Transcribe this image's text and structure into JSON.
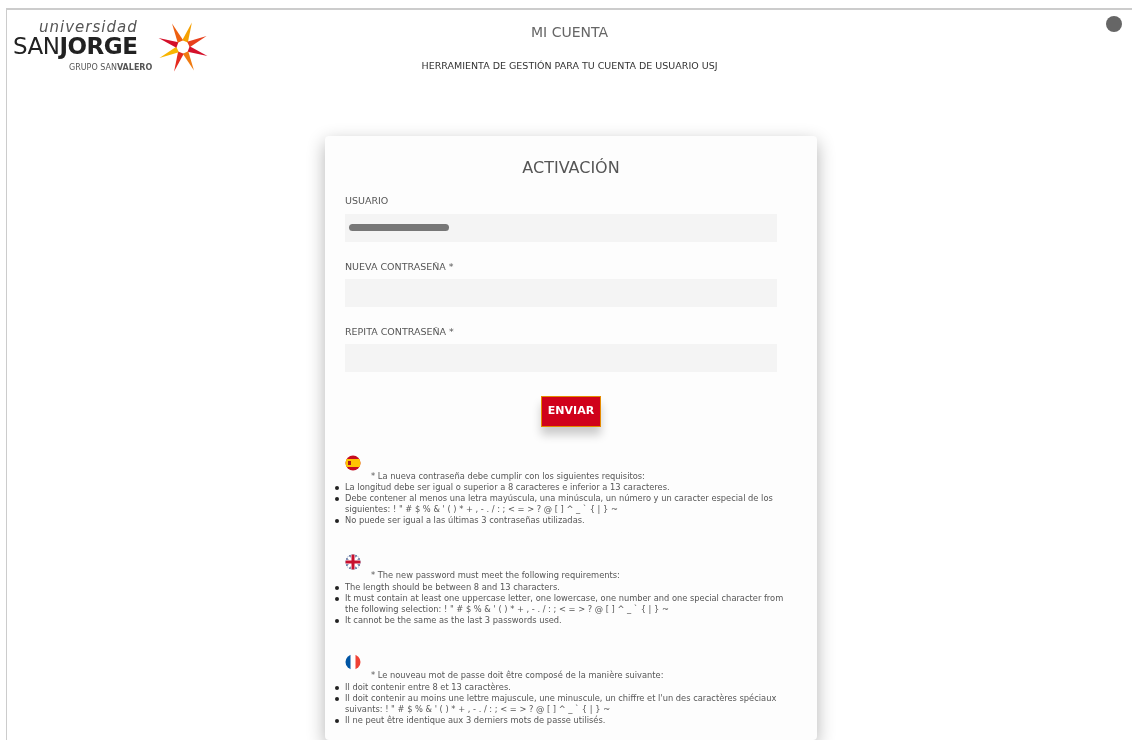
{
  "logo": {
    "top": "universidad",
    "main": "SAN**JORGE**",
    "sub": "GRUPO SAN**VALERO**"
  },
  "header": {
    "title": "MI CUENTA",
    "subtitle": "HERRAMIENTA DE GESTIÓN PARA TU CUENTA DE USUARIO USJ"
  },
  "form": {
    "title": "ACTIVACIÓN",
    "fields": [
      {
        "label": "USUARIO",
        "redacted": true
      },
      {
        "label": "NUEVA CONTRASEÑA *",
        "redacted": false
      },
      {
        "label": "REPITA CONTRASEÑA *",
        "redacted": false
      }
    ],
    "submit": "ENVIAR"
  },
  "requirements": [
    {
      "kind": "es",
      "intro": "* La nueva contraseña debe cumplir con los siguientes requisitos:",
      "items": [
        "La longitud debe ser igual o superior a 8 caracteres e inferior a 13 caracteres.",
        "Debe contener al menos una letra mayúscula, una minúscula, un número y un caracter especial de los siguientes: ! \" # $ % & ' ( ) * + , - . / : ; < = > ? @ [ ] ^ _ ` { | } ~",
        "No puede ser igual a las últimas 3 contraseñas utilizadas."
      ]
    },
    {
      "kind": "en",
      "intro": "* The new password must meet the following requirements:",
      "items": [
        "The length should be between 8 and 13 characters.",
        "It must contain at least one uppercase letter, one lowercase, one number and one special character from the following selection: ! \" # $ % & ' ( ) * + , - . / : ; < = > ? @ [ ] ^ _ ` { | } ~",
        "It cannot be the same as the last 3 passwords used."
      ]
    },
    {
      "kind": "fr",
      "intro": "* Le nouveau mot de passe doit être composé de la manière suivante:",
      "items": [
        "Il doit contenir entre 8 et 13 caractères.",
        "Il doit contenir au moins une lettre majuscule, une minuscule, un chiffre et l'un des caractères spéciaux suivants: ! \" # $ % & ' ( ) * + , - . / : ; < = > ? @ [ ] ^ _ ` { | } ~",
        "Il ne peut être identique aux 3 derniers mots de passe utilisés."
      ]
    }
  ]
}
